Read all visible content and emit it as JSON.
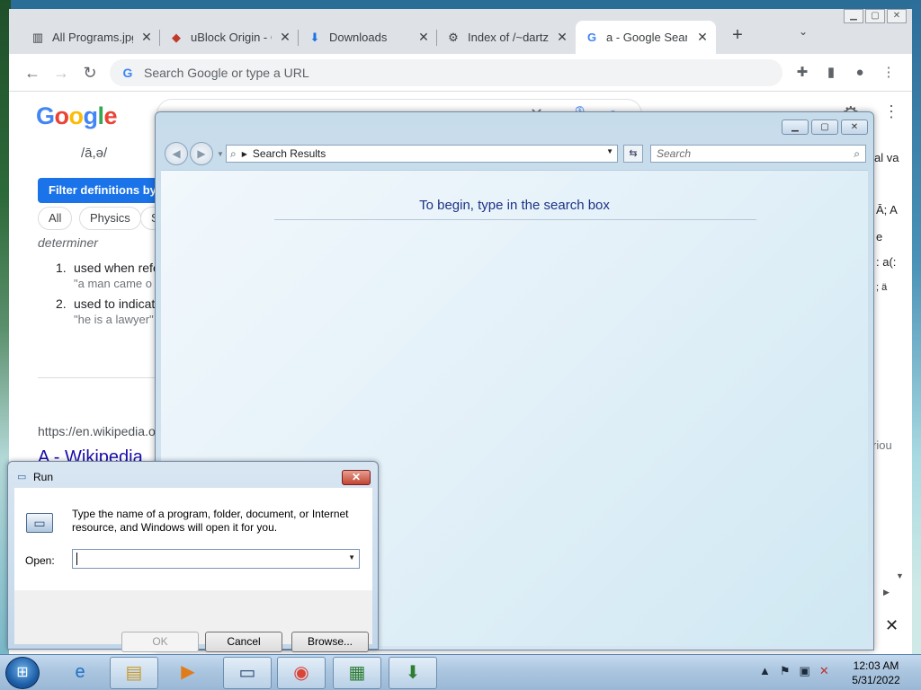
{
  "chrome": {
    "tabs": [
      {
        "title": "All Programs.jpg",
        "icon": "image-icon",
        "active": false
      },
      {
        "title": "uBlock Origin - C",
        "icon": "ublock-icon",
        "active": false
      },
      {
        "title": "Downloads",
        "icon": "download-icon",
        "active": false
      },
      {
        "title": "Index of /~dartz",
        "icon": "folder-icon",
        "active": false
      },
      {
        "title": "a - Google Searc",
        "icon": "google-icon",
        "active": true
      }
    ],
    "omnibox_placeholder": "Search Google or type a URL"
  },
  "google": {
    "query": "a",
    "phonetic": "/ā,ə/",
    "filter_label": "Filter definitions by to",
    "chips": [
      "All",
      "Physics",
      "S"
    ],
    "part_of_speech": "determiner",
    "definitions": [
      {
        "num": "1.",
        "text": "used when refe",
        "example": "\"a man came o"
      },
      {
        "num": "2.",
        "text": "used to indicat",
        "example": "\"he is a lawyer\""
      }
    ],
    "wiki_url": "https://en.wikipedia.o",
    "wiki_title": "A - Wikipedia",
    "right_fragments": [
      "al va",
      "Ā; A",
      "e",
      ": a(:",
      "; ä",
      "riou"
    ]
  },
  "search_window": {
    "address": "Search Results",
    "search_placeholder": "Search",
    "message": "To begin, type in the search box"
  },
  "run_dialog": {
    "title": "Run",
    "description": "Type the name of a program, folder, document, or Internet resource, and Windows will open it for you.",
    "open_label": "Open:",
    "open_value": "",
    "ok": "OK",
    "cancel": "Cancel",
    "browse": "Browse..."
  },
  "taskbar": {
    "time": "12:03 AM",
    "date": "5/31/2022"
  }
}
